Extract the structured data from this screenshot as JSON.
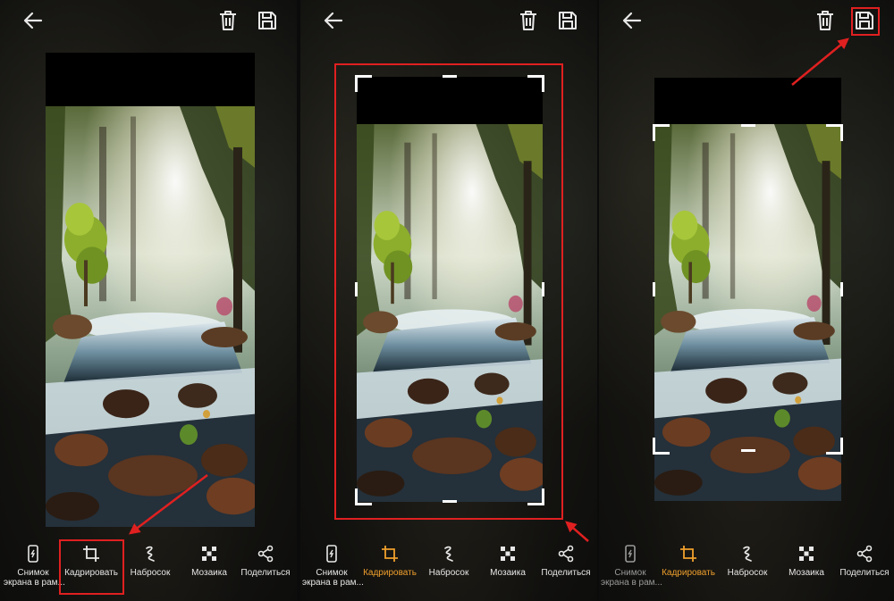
{
  "panels": [
    {
      "id": "step-1",
      "toolbar": {
        "active": "crop",
        "tools": [
          {
            "key": "screenshot",
            "label_line1": "Снимок",
            "label_line2": "экрана в рам...",
            "icon": "phone-screenshot-icon"
          },
          {
            "key": "crop",
            "label_line1": "Кадрировать",
            "label_line2": "",
            "icon": "crop-icon"
          },
          {
            "key": "sketch",
            "label_line1": "Набросок",
            "label_line2": "",
            "icon": "scribble-icon"
          },
          {
            "key": "mosaic",
            "label_line1": "Мозаика",
            "label_line2": "",
            "icon": "mosaic-icon"
          },
          {
            "key": "share",
            "label_line1": "Поделиться",
            "label_line2": "",
            "icon": "share-icon"
          }
        ]
      }
    },
    {
      "id": "step-2",
      "toolbar": {
        "active": "crop",
        "tools": [
          {
            "key": "screenshot",
            "label_line1": "Снимок",
            "label_line2": "экрана в рам...",
            "icon": "phone-screenshot-icon"
          },
          {
            "key": "crop",
            "label_line1": "Кадрировать",
            "label_line2": "",
            "icon": "crop-icon"
          },
          {
            "key": "sketch",
            "label_line1": "Набросок",
            "label_line2": "",
            "icon": "scribble-icon"
          },
          {
            "key": "mosaic",
            "label_line1": "Мозаика",
            "label_line2": "",
            "icon": "mosaic-icon"
          },
          {
            "key": "share",
            "label_line1": "Поделиться",
            "label_line2": "",
            "icon": "share-icon"
          }
        ]
      }
    },
    {
      "id": "step-3",
      "toolbar": {
        "active": "crop",
        "tools": [
          {
            "key": "screenshot",
            "label_line1": "Снимок",
            "label_line2": "экрана в рам...",
            "icon": "phone-screenshot-icon"
          },
          {
            "key": "crop",
            "label_line1": "Кадрировать",
            "label_line2": "",
            "icon": "crop-icon"
          },
          {
            "key": "sketch",
            "label_line1": "Набросок",
            "label_line2": "",
            "icon": "scribble-icon"
          },
          {
            "key": "mosaic",
            "label_line1": "Мозаика",
            "label_line2": "",
            "icon": "mosaic-icon"
          },
          {
            "key": "share",
            "label_line1": "Поделиться",
            "label_line2": "",
            "icon": "share-icon"
          }
        ]
      }
    }
  ],
  "icons": {
    "back": "arrow-left-icon",
    "delete": "trash-icon",
    "save": "floppy-disk-icon"
  },
  "colors": {
    "accent": "#f0a02c",
    "annotation": "#e02020",
    "handle": "#ffffff",
    "text": "#e6e6e6",
    "text_dim": "#9a9a9a"
  }
}
